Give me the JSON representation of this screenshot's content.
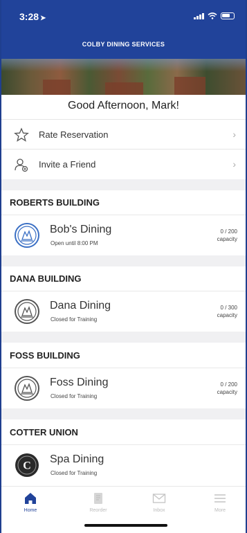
{
  "status": {
    "time": "3:28"
  },
  "header": {
    "title": "COLBY DINING SERVICES"
  },
  "greeting": "Good Afternoon, Mark!",
  "menu": [
    {
      "label": "Rate Reservation",
      "icon": "star-icon"
    },
    {
      "label": "Invite a Friend",
      "icon": "add-person-icon"
    }
  ],
  "sections": [
    {
      "heading": "ROBERTS BUILDING",
      "dining": {
        "name": "Bob's Dining",
        "status": "Open until 8:00 PM",
        "capacity": "0 / 200",
        "capacity_label": "capacity",
        "logo": "bobs-logo-icon"
      }
    },
    {
      "heading": "DANA BUILDING",
      "dining": {
        "name": "Dana Dining",
        "status": "Closed for Training",
        "capacity": "0 / 300",
        "capacity_label": "capacity",
        "logo": "dana-logo-icon"
      }
    },
    {
      "heading": "FOSS BUILDING",
      "dining": {
        "name": "Foss Dining",
        "status": "Closed for Training",
        "capacity": "0 / 200",
        "capacity_label": "capacity",
        "logo": "foss-logo-icon"
      }
    },
    {
      "heading": "COTTER UNION",
      "dining": {
        "name": "Spa Dining",
        "status": "Closed for Training",
        "logo": "spa-logo-icon"
      }
    }
  ],
  "tabs": [
    {
      "label": "Home",
      "icon": "home-icon"
    },
    {
      "label": "Reorder",
      "icon": "reorder-icon"
    },
    {
      "label": "Inbox",
      "icon": "inbox-icon"
    },
    {
      "label": "More",
      "icon": "menu-icon"
    }
  ],
  "colors": {
    "brand": "#21439a",
    "logo_blue": "#3a6fc4",
    "logo_gray": "#555555"
  }
}
